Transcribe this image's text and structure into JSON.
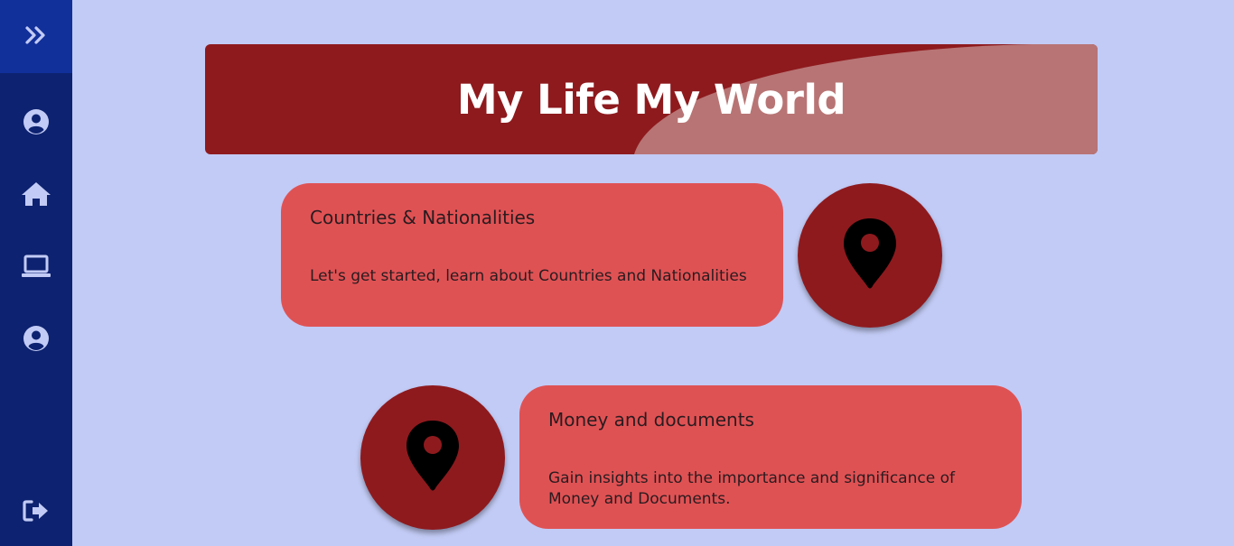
{
  "sidebar": {
    "toggle_icon": "double-chevron-right-icon",
    "items": [
      {
        "name": "profile",
        "icon": "user-circle-icon"
      },
      {
        "name": "home",
        "icon": "home-icon"
      },
      {
        "name": "laptop",
        "icon": "laptop-icon"
      },
      {
        "name": "account",
        "icon": "user-circle-icon"
      }
    ],
    "logout_icon": "sign-out-icon"
  },
  "banner": {
    "title": "My Life My World"
  },
  "topics": [
    {
      "title": "Countries & Nationalities",
      "description": "Let's get started, learn about Countries and Nationalities",
      "icon": "map-marker-icon"
    },
    {
      "title": "Money and documents",
      "description": "Gain insights into the importance and significance of Money and Documents.",
      "icon": "map-marker-icon"
    }
  ],
  "colors": {
    "page_background": "#c2cbf5",
    "sidebar": "#0d2270",
    "sidebar_toggle": "#12309a",
    "banner": "#8e1a1e",
    "card": "#df5254",
    "circle": "#8e1a1e",
    "icon_light": "#c2cbf5"
  }
}
